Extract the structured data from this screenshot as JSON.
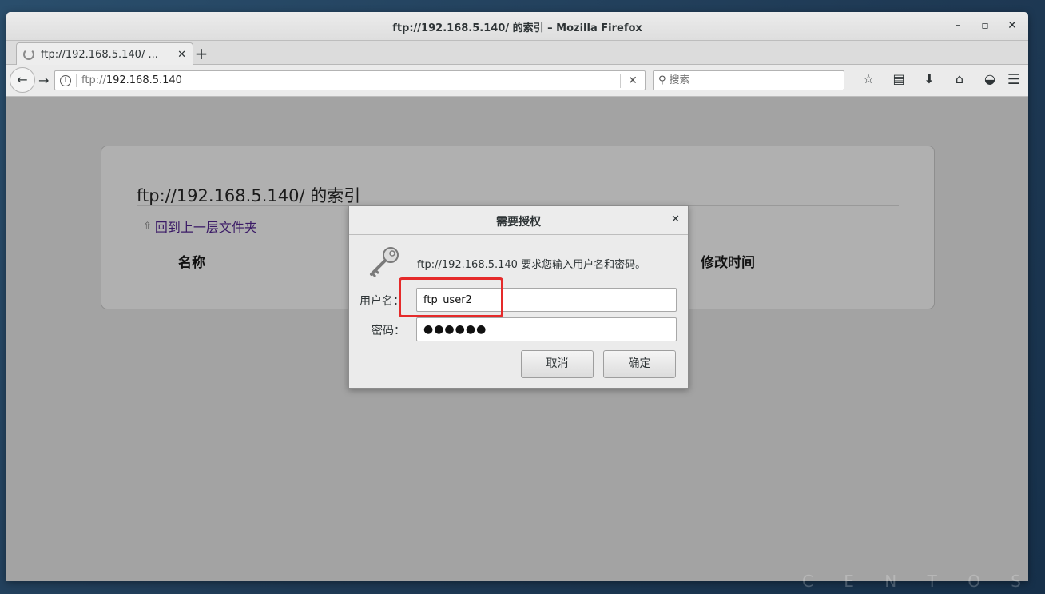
{
  "window": {
    "title": "ftp://192.168.5.140/ 的索引  –  Mozilla Firefox"
  },
  "tab": {
    "label": "ftp://192.168.5.140/ ..."
  },
  "url": {
    "protocol": "ftp://",
    "host": "192.168.5.140"
  },
  "search": {
    "placeholder": "搜索"
  },
  "page": {
    "heading": "ftp://192.168.5.140/ 的索引",
    "up_link": "回到上一层文件夹",
    "col_name": "名称",
    "col_time": "修改时间"
  },
  "dialog": {
    "title": "需要授权",
    "prompt": "ftp://192.168.5.140 要求您输入用户名和密码。",
    "username_label": "用户名：",
    "username_value": "ftp_user2",
    "password_label": "密码：",
    "password_value": "●●●●●●",
    "cancel_label": "取消",
    "ok_label": "确定"
  },
  "desktop": {
    "brand": "C E N T O S"
  },
  "colors": {
    "highlight": "#e52a2a",
    "link": "#3a1a66"
  }
}
